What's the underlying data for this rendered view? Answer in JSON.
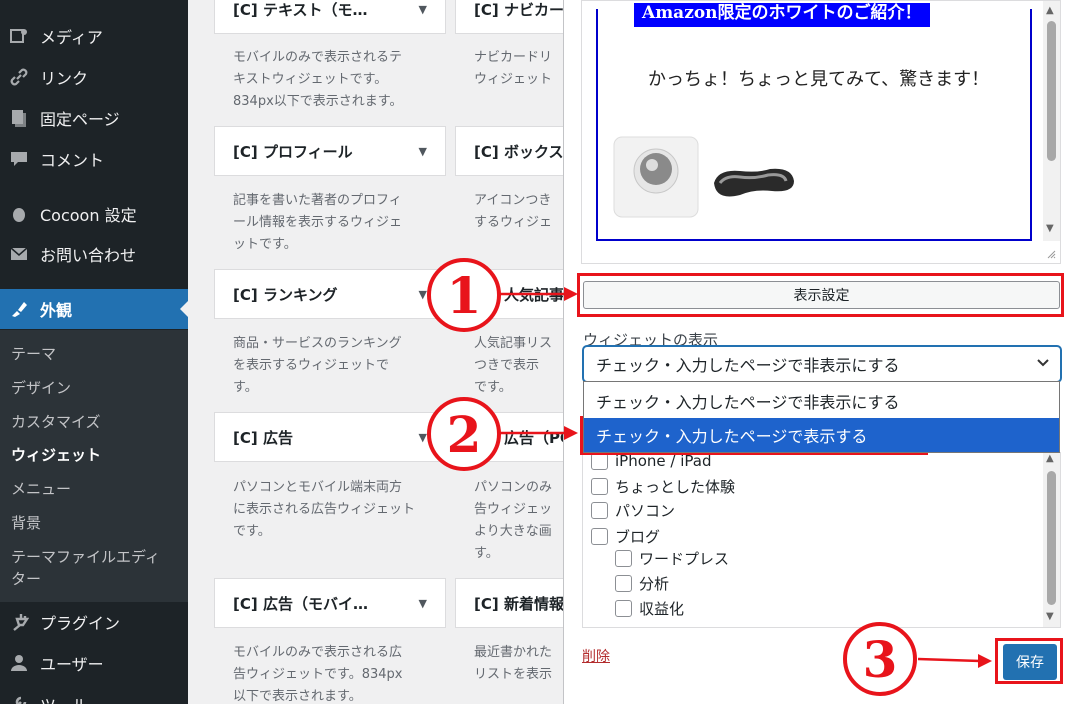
{
  "sidebar": {
    "items": [
      {
        "label": "メディア",
        "icon": "media-icon"
      },
      {
        "label": "リンク",
        "icon": "link-icon"
      },
      {
        "label": "固定ページ",
        "icon": "page-icon"
      },
      {
        "label": "コメント",
        "icon": "comment-icon"
      },
      {
        "label": "Cocoon 設定",
        "icon": "cocoon-icon"
      },
      {
        "label": "お問い合わせ",
        "icon": "mail-icon"
      },
      {
        "label": "外観",
        "icon": "appearance-icon"
      },
      {
        "label": "プラグイン",
        "icon": "plugin-icon"
      },
      {
        "label": "ユーザー",
        "icon": "user-icon"
      },
      {
        "label": "ツール",
        "icon": "tool-icon"
      }
    ],
    "submenu": [
      "テーマ",
      "デザイン",
      "カスタマイズ",
      "ウィジェット",
      "メニュー",
      "背景",
      "テーマファイルエディ",
      "ター"
    ]
  },
  "widgets": {
    "left": [
      {
        "title": "[C] テキスト（モ…",
        "desc": [
          "モバイルのみで表示されるテ",
          "キストウィジェットです。",
          "834px以下で表示されます。"
        ]
      },
      {
        "title": "[C] プロフィール",
        "desc": [
          "記事を書いた著者のプロフィ",
          "ール情報を表示するウィジェ",
          "ットです。"
        ]
      },
      {
        "title": "[C] ランキング",
        "desc": [
          "商品・サービスのランキング",
          "を表示するウィジェットで",
          "す。"
        ]
      },
      {
        "title": "[C] 広告",
        "desc": [
          "パソコンとモバイル端末両方",
          "に表示される広告ウィジェット",
          "です。"
        ]
      },
      {
        "title": "[C] 広告（モバイ…",
        "desc": [
          "モバイルのみで表示される広",
          "告ウィジェットです。834px",
          "以下で表示されます。"
        ]
      }
    ],
    "right": [
      {
        "title": "[C] ナビカー",
        "desc": [
          "ナビカードリ",
          "ウィジェット"
        ]
      },
      {
        "title": "[C] ボックス",
        "desc": [
          "アイコンつき",
          "するウィジェ"
        ]
      },
      {
        "title": "[C] 人気記事",
        "desc": [
          "人気記事リス",
          "つきで表示",
          "です。"
        ]
      },
      {
        "title": "[C] 広告（PC",
        "desc": [
          "パソコンのみ",
          "告ウィジェッ",
          "より大きな画",
          "す。"
        ]
      },
      {
        "title": "[C] 新着情報",
        "desc": [
          "最近書かれた",
          "リストを表示"
        ]
      }
    ]
  },
  "panel": {
    "preview_title": "Amazon限定のホワイトのご紹介！",
    "preview_text": "かっちょ！ちょっと見てみて、驚きます！",
    "display_button": "表示設定",
    "visibility_label": "ウィジェットの表示",
    "visibility_selected": "チェック・入力したページで非表示にする",
    "options": [
      "チェック・入力したページで非表示にする",
      "チェック・入力したページで表示する"
    ],
    "categories": [
      {
        "label": "iPhone / iPad",
        "level": 0
      },
      {
        "label": "ちょっとした体験",
        "level": 0
      },
      {
        "label": "パソコン",
        "level": 0
      },
      {
        "label": "ブログ",
        "level": 0
      },
      {
        "label": "ワードプレス",
        "level": 1
      },
      {
        "label": "分析",
        "level": 1
      },
      {
        "label": "収益化",
        "level": 1
      }
    ],
    "delete_label": "削除",
    "save_label": "保存"
  },
  "annotations": {
    "one": "1",
    "two": "2",
    "three": "3",
    "color": "#e8141b"
  },
  "colors": {
    "accent": "#2271b1",
    "sidebar": "#1d2327",
    "annotation": "#e8141b"
  }
}
